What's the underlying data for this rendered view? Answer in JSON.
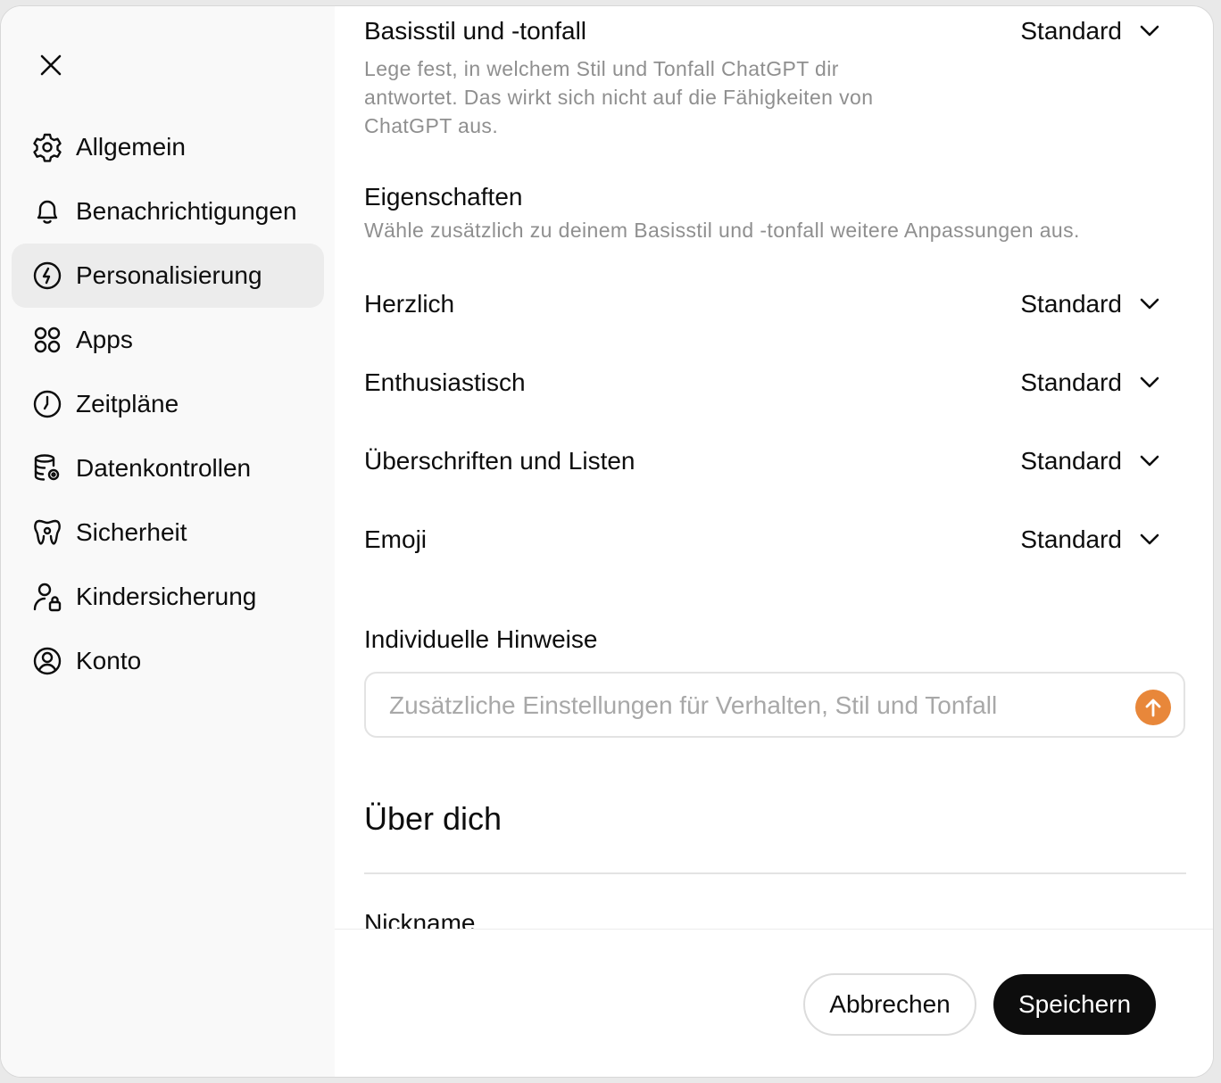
{
  "sidebar": {
    "close_icon": "close-icon",
    "items": [
      {
        "label": "Allgemein",
        "icon": "gear-icon",
        "active": false
      },
      {
        "label": "Benachrichtigungen",
        "icon": "bell-icon",
        "active": false
      },
      {
        "label": "Personalisierung",
        "icon": "personalization-icon",
        "active": true
      },
      {
        "label": "Apps",
        "icon": "apps-grid-icon",
        "active": false
      },
      {
        "label": "Zeitpläne",
        "icon": "clock-icon",
        "active": false
      },
      {
        "label": "Datenkontrollen",
        "icon": "database-gear-icon",
        "active": false
      },
      {
        "label": "Sicherheit",
        "icon": "security-icon",
        "active": false
      },
      {
        "label": "Kindersicherung",
        "icon": "user-lock-icon",
        "active": false
      },
      {
        "label": "Konto",
        "icon": "account-circle-icon",
        "active": false
      }
    ]
  },
  "main": {
    "base_style": {
      "title": "Basisstil und -tonfall",
      "value": "Standard",
      "description": "Lege fest, in welchem Stil und Tonfall ChatGPT dir antwortet. Das wirkt sich nicht auf die Fähigkeiten von ChatGPT aus."
    },
    "traits": {
      "title": "Eigenschaften",
      "description": "Wähle zusätzlich zu deinem Basisstil und -tonfall weitere Anpassungen aus."
    },
    "options": [
      {
        "label": "Herzlich",
        "value": "Standard"
      },
      {
        "label": "Enthusiastisch",
        "value": "Standard"
      },
      {
        "label": "Überschriften und Listen",
        "value": "Standard"
      },
      {
        "label": "Emoji",
        "value": "Standard"
      }
    ],
    "custom_instructions": {
      "title": "Individuelle Hinweise",
      "value": "",
      "placeholder": "Zusätzliche Einstellungen für Verhalten, Stil und Tonfall"
    },
    "about_you": {
      "title": "Über dich",
      "partial_label": "Nickname"
    }
  },
  "footer": {
    "cancel_label": "Abbrechen",
    "save_label": "Speichern"
  },
  "colors": {
    "accent": "#e8873a",
    "sidebar_bg": "#f9f9f9",
    "active_item_bg": "#ececec",
    "primary_button": "#0d0d0d"
  }
}
